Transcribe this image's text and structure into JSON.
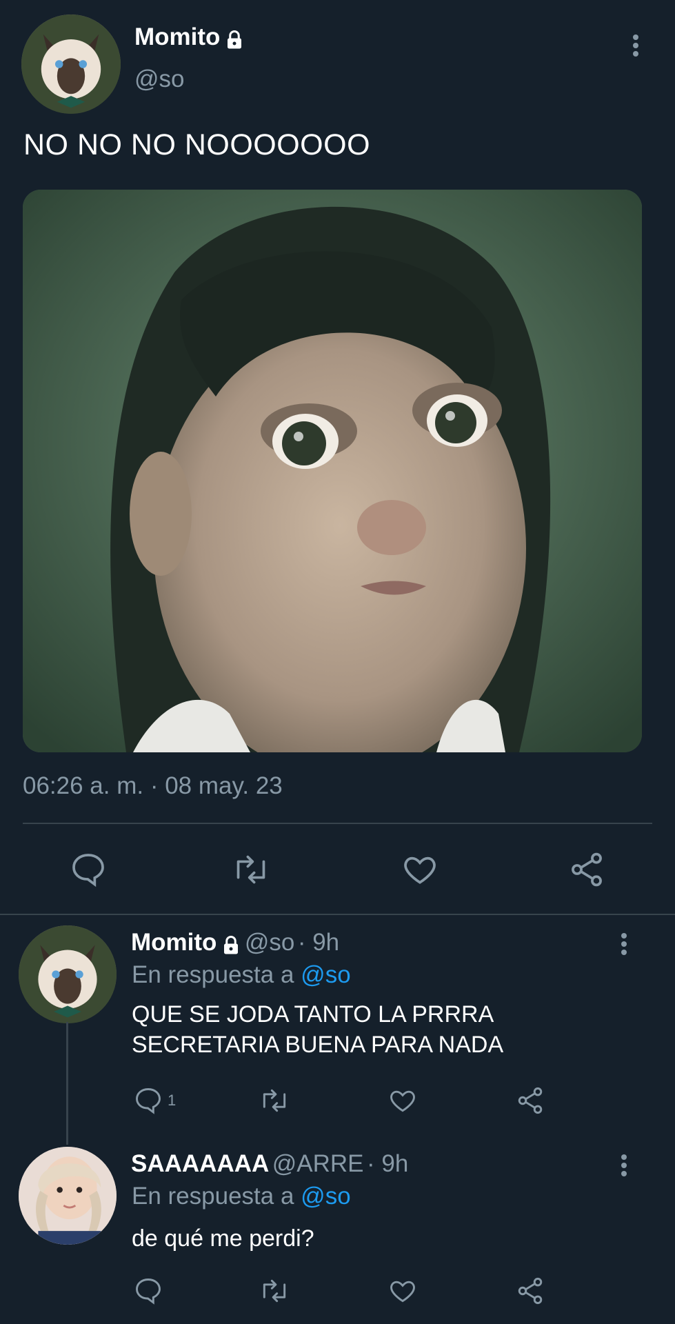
{
  "main_tweet": {
    "author": "Momito",
    "handle": "@so",
    "text": "NO NO NO NOOOOOOO",
    "timestamp": "06:26 a. m. · 08 may. 23"
  },
  "replies": [
    {
      "author": "Momito",
      "handle": "@so",
      "time": "· 9h",
      "reply_prefix": "En respuesta a",
      "reply_to": "@so",
      "text_line1": "QUE SE JODA TANTO LA PRRRA",
      "text_line2": "SECRETARIA BUENA PARA NADA",
      "reply_count": "1"
    },
    {
      "author": "SAAAAAAA",
      "handle": "@ARRE",
      "time": "· 9h",
      "reply_prefix": "En respuesta a",
      "reply_to": "@so",
      "text_line1": "de qué me perdi?"
    }
  ],
  "icons": {
    "reply": "reply-icon",
    "retweet": "retweet-icon",
    "like": "heart-icon",
    "share": "share-icon",
    "more": "more-options-icon",
    "lock": "lock-icon"
  },
  "colors": {
    "background": "#15202b",
    "muted": "#8899a6",
    "accent": "#1d9bf0",
    "divider": "#38444d"
  }
}
